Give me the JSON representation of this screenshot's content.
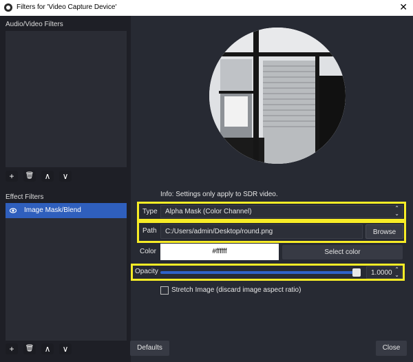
{
  "window": {
    "title": "Filters for 'Video Capture Device'",
    "close_glyph": "✕"
  },
  "left": {
    "av_filters_label": "Audio/Video Filters",
    "effect_filters_label": "Effect Filters",
    "effect_items": [
      {
        "label": "Image Mask/Blend"
      }
    ],
    "toolbar_icons": {
      "add": "+",
      "remove": "🗑",
      "up": "∧",
      "down": "∨"
    }
  },
  "info_text": "Info: Settings only apply to SDR video.",
  "settings": {
    "type_label": "Type",
    "type_value": "Alpha Mask (Color Channel)",
    "path_label": "Path",
    "path_value": "C:/Users/admin/Desktop/round.png",
    "browse_label": "Browse",
    "color_label": "Color",
    "color_value": "#ffffff",
    "select_color_label": "Select color",
    "opacity_label": "Opacity",
    "opacity_value": "1.0000",
    "opacity_fraction": 1.0,
    "stretch_label": "Stretch Image (discard image aspect ratio)"
  },
  "footer": {
    "defaults_label": "Defaults",
    "close_label": "Close"
  },
  "colors": {
    "highlight": "#f7ec26",
    "accent": "#2f5fbd"
  }
}
